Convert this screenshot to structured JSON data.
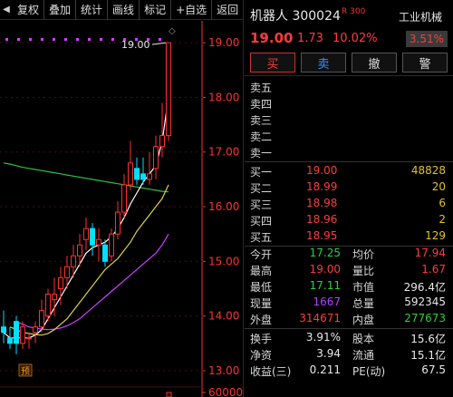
{
  "toolbar": {
    "items": [
      "复权",
      "叠加",
      "统计",
      "画线",
      "标记",
      "+自选",
      "返回"
    ]
  },
  "chart": {
    "y_ticks": [
      "19.00",
      "18.00",
      "17.00",
      "16.00",
      "15.00",
      "14.00",
      "13.00",
      "60000"
    ],
    "high_label": "19.00",
    "marker_label": "预",
    "colors": {
      "up": "#ff3030",
      "down": "#00e0ff",
      "ma5": "#ffffff",
      "ma10": "#e0d040",
      "ma20": "#d040ff",
      "ma60": "#30c040",
      "dots": "#d040ff",
      "axis": "#ff3030"
    }
  },
  "chart_data": {
    "type": "candlestick",
    "y_range": [
      12.8,
      19.4
    ],
    "candles": [
      {
        "o": 13.8,
        "h": 14.1,
        "l": 13.5,
        "c": 13.7
      },
      {
        "o": 13.6,
        "h": 13.8,
        "l": 13.4,
        "c": 13.5
      },
      {
        "o": 13.9,
        "h": 14.0,
        "l": 13.3,
        "c": 13.5
      },
      {
        "o": 13.5,
        "h": 13.9,
        "l": 13.4,
        "c": 13.8
      },
      {
        "o": 13.6,
        "h": 13.7,
        "l": 13.4,
        "c": 13.6
      },
      {
        "o": 13.7,
        "h": 13.9,
        "l": 13.5,
        "c": 13.8
      },
      {
        "o": 13.8,
        "h": 14.3,
        "l": 13.7,
        "c": 14.1
      },
      {
        "o": 14.0,
        "h": 14.5,
        "l": 13.9,
        "c": 14.4
      },
      {
        "o": 14.3,
        "h": 14.7,
        "l": 14.0,
        "c": 14.4
      },
      {
        "o": 14.5,
        "h": 14.9,
        "l": 14.2,
        "c": 14.7
      },
      {
        "o": 14.7,
        "h": 15.1,
        "l": 14.5,
        "c": 14.9
      },
      {
        "o": 14.9,
        "h": 15.3,
        "l": 14.7,
        "c": 15.1
      },
      {
        "o": 15.1,
        "h": 15.5,
        "l": 14.9,
        "c": 15.3
      },
      {
        "o": 15.4,
        "h": 15.8,
        "l": 15.2,
        "c": 15.6
      },
      {
        "o": 15.6,
        "h": 15.7,
        "l": 15.1,
        "c": 15.3
      },
      {
        "o": 15.3,
        "h": 15.6,
        "l": 15.0,
        "c": 15.4
      },
      {
        "o": 15.3,
        "h": 15.4,
        "l": 14.9,
        "c": 15.0
      },
      {
        "o": 15.1,
        "h": 15.6,
        "l": 15.0,
        "c": 15.5
      },
      {
        "o": 15.5,
        "h": 16.1,
        "l": 15.4,
        "c": 15.9
      },
      {
        "o": 15.9,
        "h": 16.6,
        "l": 15.8,
        "c": 16.4
      },
      {
        "o": 16.4,
        "h": 17.2,
        "l": 16.3,
        "c": 16.8
      },
      {
        "o": 16.7,
        "h": 16.9,
        "l": 16.4,
        "c": 16.5
      },
      {
        "o": 16.6,
        "h": 16.9,
        "l": 16.4,
        "c": 16.5
      },
      {
        "o": 16.5,
        "h": 17.0,
        "l": 16.4,
        "c": 16.6
      },
      {
        "o": 16.7,
        "h": 17.3,
        "l": 16.5,
        "c": 17.1
      },
      {
        "o": 17.1,
        "h": 17.9,
        "l": 16.9,
        "c": 17.3
      },
      {
        "o": 17.3,
        "h": 19.0,
        "l": 17.2,
        "c": 19.0
      }
    ],
    "ma5": [
      13.7,
      13.6,
      13.6,
      13.6,
      13.6,
      13.65,
      13.75,
      13.95,
      14.15,
      14.35,
      14.55,
      14.75,
      14.95,
      15.15,
      15.25,
      15.3,
      15.35,
      15.45,
      15.6,
      15.8,
      16.05,
      16.25,
      16.45,
      16.6,
      16.75,
      17.2,
      18.0
    ],
    "ma10": [
      13.8,
      13.75,
      13.7,
      13.68,
      13.66,
      13.65,
      13.68,
      13.75,
      13.85,
      13.95,
      14.1,
      14.25,
      14.4,
      14.55,
      14.7,
      14.85,
      14.95,
      15.05,
      15.2,
      15.35,
      15.55,
      15.7,
      15.85,
      16.0,
      16.15,
      16.4
    ],
    "ma20": [
      13.9,
      13.85,
      13.8,
      13.78,
      13.76,
      13.75,
      13.76,
      13.78,
      13.82,
      13.88,
      13.95,
      14.05,
      14.15,
      14.25,
      14.35,
      14.45,
      14.55,
      14.65,
      14.75,
      14.85,
      14.95,
      15.05,
      15.15,
      15.3,
      15.5
    ],
    "ma60": [
      16.8,
      16.78,
      16.75,
      16.72,
      16.7,
      16.68,
      16.66,
      16.64,
      16.62,
      16.6,
      16.58,
      16.56,
      16.54,
      16.52,
      16.5,
      16.48,
      16.46,
      16.44,
      16.42,
      16.4,
      16.38,
      16.36,
      16.34,
      16.32,
      16.3,
      16.28,
      16.27
    ]
  },
  "quote": {
    "name": "机器人 300024",
    "tag": "R 300",
    "industry": "工业机械",
    "price": "19.00",
    "change": "1.73",
    "change_pct": "10.02%",
    "industry_pct": "3.51%",
    "actions": [
      "买",
      "卖",
      "撤",
      "警"
    ]
  },
  "asks": [
    {
      "label": "卖五",
      "price": "",
      "vol": ""
    },
    {
      "label": "卖四",
      "price": "",
      "vol": ""
    },
    {
      "label": "卖三",
      "price": "",
      "vol": ""
    },
    {
      "label": "卖二",
      "price": "",
      "vol": ""
    },
    {
      "label": "卖一",
      "price": "",
      "vol": ""
    }
  ],
  "bids": [
    {
      "label": "买一",
      "price": "19.00",
      "vol": "48828"
    },
    {
      "label": "买二",
      "price": "18.99",
      "vol": "20"
    },
    {
      "label": "买三",
      "price": "18.98",
      "vol": "6"
    },
    {
      "label": "买四",
      "price": "18.96",
      "vol": "2"
    },
    {
      "label": "买五",
      "price": "18.95",
      "vol": "129"
    }
  ],
  "stats": [
    [
      {
        "k": "今开",
        "v": "17.25",
        "c": "green"
      },
      {
        "k": "均价",
        "v": "17.94",
        "c": "red"
      }
    ],
    [
      {
        "k": "最高",
        "v": "19.00",
        "c": "red"
      },
      {
        "k": "量比",
        "v": "1.67",
        "c": "red"
      }
    ],
    [
      {
        "k": "最低",
        "v": "17.11",
        "c": "green"
      },
      {
        "k": "市值",
        "v": "296.4亿",
        "c": "white"
      }
    ],
    [
      {
        "k": "现量",
        "v": "1667",
        "c": "purple"
      },
      {
        "k": "总量",
        "v": "592345",
        "c": "white"
      }
    ],
    [
      {
        "k": "外盘",
        "v": "314671",
        "c": "red"
      },
      {
        "k": "内盘",
        "v": "277673",
        "c": "green"
      }
    ],
    [
      {
        "k": "换手",
        "v": "3.91%",
        "c": "white"
      },
      {
        "k": "股本",
        "v": "15.6亿",
        "c": "white"
      }
    ],
    [
      {
        "k": "净资",
        "v": "3.94",
        "c": "white"
      },
      {
        "k": "流通",
        "v": "15.1亿",
        "c": "white"
      }
    ],
    [
      {
        "k": "收益(三)",
        "v": "0.211",
        "c": "white"
      },
      {
        "k": "PE(动)",
        "v": "67.5",
        "c": "white"
      }
    ]
  ]
}
